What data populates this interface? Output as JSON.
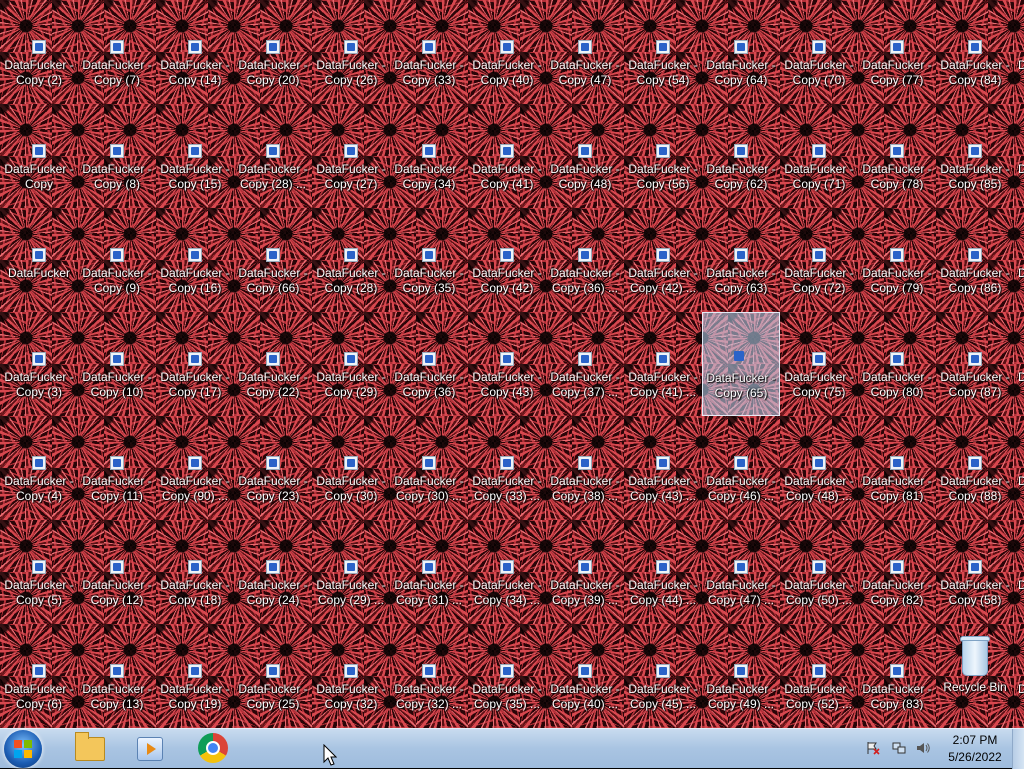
{
  "desktop": {
    "icons": [
      {
        "id": "c0-0",
        "label": "DataFucker -\nCopy (2)",
        "kind": "shortcut"
      },
      {
        "id": "c0-1",
        "label": "DataFucker -\nCopy",
        "kind": "shortcut"
      },
      {
        "id": "c0-2",
        "label": "DataFucker",
        "kind": "shortcut"
      },
      {
        "id": "c0-3",
        "label": "DataFucker -\nCopy (3)",
        "kind": "shortcut"
      },
      {
        "id": "c0-4",
        "label": "DataFucker -\nCopy (4)",
        "kind": "shortcut"
      },
      {
        "id": "c0-5",
        "label": "DataFucker -\nCopy (5)",
        "kind": "shortcut"
      },
      {
        "id": "c0-6",
        "label": "DataFucker -\nCopy (6)",
        "kind": "shortcut"
      },
      {
        "id": "c1-0",
        "label": "DataFucker -\nCopy (7)",
        "kind": "shortcut"
      },
      {
        "id": "c1-1",
        "label": "DataFucker -\nCopy (8)",
        "kind": "shortcut"
      },
      {
        "id": "c1-2",
        "label": "DataFucker -\nCopy (9)",
        "kind": "shortcut"
      },
      {
        "id": "c1-3",
        "label": "DataFucker -\nCopy (10)",
        "kind": "shortcut"
      },
      {
        "id": "c1-4",
        "label": "DataFucker -\nCopy (11)",
        "kind": "shortcut"
      },
      {
        "id": "c1-5",
        "label": "DataFucker -\nCopy (12)",
        "kind": "shortcut"
      },
      {
        "id": "c1-6",
        "label": "DataFucker -\nCopy (13)",
        "kind": "shortcut"
      },
      {
        "id": "c2-0",
        "label": "DataFucker -\nCopy (14)",
        "kind": "shortcut"
      },
      {
        "id": "c2-1",
        "label": "DataFucker -\nCopy (15)",
        "kind": "shortcut"
      },
      {
        "id": "c2-2",
        "label": "DataFucker -\nCopy (16)",
        "kind": "shortcut"
      },
      {
        "id": "c2-3",
        "label": "DataFucker -\nCopy (17)",
        "kind": "shortcut"
      },
      {
        "id": "c2-4",
        "label": "DataFucker -\nCopy (90) ...",
        "kind": "shortcut"
      },
      {
        "id": "c2-5",
        "label": "DataFucker -\nCopy (18)",
        "kind": "shortcut"
      },
      {
        "id": "c2-6",
        "label": "DataFucker -\nCopy (19)",
        "kind": "shortcut"
      },
      {
        "id": "c3-0",
        "label": "DataFucker -\nCopy (20)",
        "kind": "shortcut"
      },
      {
        "id": "c3-1",
        "label": "DataFucker -\nCopy (28) ...",
        "kind": "shortcut"
      },
      {
        "id": "c3-2",
        "label": "DataFucker -\nCopy (66)",
        "kind": "shortcut"
      },
      {
        "id": "c3-3",
        "label": "DataFucker -\nCopy (22)",
        "kind": "shortcut"
      },
      {
        "id": "c3-4",
        "label": "DataFucker -\nCopy (23)",
        "kind": "shortcut"
      },
      {
        "id": "c3-5",
        "label": "DataFucker -\nCopy (24)",
        "kind": "shortcut"
      },
      {
        "id": "c3-6",
        "label": "DataFucker -\nCopy (25)",
        "kind": "shortcut"
      },
      {
        "id": "c4-0",
        "label": "DataFucker -\nCopy (26)",
        "kind": "shortcut"
      },
      {
        "id": "c4-1",
        "label": "DataFucker -\nCopy (27)",
        "kind": "shortcut"
      },
      {
        "id": "c4-2",
        "label": "DataFucker -\nCopy (28)",
        "kind": "shortcut"
      },
      {
        "id": "c4-3",
        "label": "DataFucker -\nCopy (29)",
        "kind": "shortcut"
      },
      {
        "id": "c4-4",
        "label": "DataFucker -\nCopy (30)",
        "kind": "shortcut"
      },
      {
        "id": "c4-5",
        "label": "DataFucker -\nCopy (29) ...",
        "kind": "shortcut"
      },
      {
        "id": "c4-6",
        "label": "DataFucker -\nCopy (32)",
        "kind": "shortcut"
      },
      {
        "id": "c5-0",
        "label": "DataFucker -\nCopy (33)",
        "kind": "shortcut"
      },
      {
        "id": "c5-1",
        "label": "DataFucker -\nCopy (34)",
        "kind": "shortcut"
      },
      {
        "id": "c5-2",
        "label": "DataFucker -\nCopy (35)",
        "kind": "shortcut"
      },
      {
        "id": "c5-3",
        "label": "DataFucker -\nCopy (36)",
        "kind": "shortcut"
      },
      {
        "id": "c5-4",
        "label": "DataFucker -\nCopy (30) ...",
        "kind": "shortcut"
      },
      {
        "id": "c5-5",
        "label": "DataFucker -\nCopy (31) ...",
        "kind": "shortcut"
      },
      {
        "id": "c5-6",
        "label": "DataFucker -\nCopy (32) ...",
        "kind": "shortcut"
      },
      {
        "id": "c6-0",
        "label": "DataFucker -\nCopy (40)",
        "kind": "shortcut"
      },
      {
        "id": "c6-1",
        "label": "DataFucker -\nCopy (41)",
        "kind": "shortcut"
      },
      {
        "id": "c6-2",
        "label": "DataFucker -\nCopy (42)",
        "kind": "shortcut"
      },
      {
        "id": "c6-3",
        "label": "DataFucker -\nCopy (43)",
        "kind": "shortcut"
      },
      {
        "id": "c6-4",
        "label": "DataFucker -\nCopy (33) ...",
        "kind": "shortcut"
      },
      {
        "id": "c6-5",
        "label": "DataFucker -\nCopy (34) ...",
        "kind": "shortcut"
      },
      {
        "id": "c6-6",
        "label": "DataFucker -\nCopy (35) ...",
        "kind": "shortcut"
      },
      {
        "id": "c7-0",
        "label": "DataFucker -\nCopy (47)",
        "kind": "shortcut"
      },
      {
        "id": "c7-1",
        "label": "DataFucker -\nCopy (48)",
        "kind": "shortcut"
      },
      {
        "id": "c7-2",
        "label": "DataFucker -\nCopy (36) ...",
        "kind": "shortcut"
      },
      {
        "id": "c7-3",
        "label": "DataFucker -\nCopy (37) ...",
        "kind": "shortcut"
      },
      {
        "id": "c7-4",
        "label": "DataFucker -\nCopy (38) ...",
        "kind": "shortcut"
      },
      {
        "id": "c7-5",
        "label": "DataFucker -\nCopy (39) ...",
        "kind": "shortcut"
      },
      {
        "id": "c7-6",
        "label": "DataFucker -\nCopy (40) ...",
        "kind": "shortcut"
      },
      {
        "id": "c8-0",
        "label": "DataFucker -\nCopy (54)",
        "kind": "shortcut"
      },
      {
        "id": "c8-1",
        "label": "DataFucker -\nCopy (56)",
        "kind": "shortcut"
      },
      {
        "id": "c8-2",
        "label": "DataFucker -\nCopy (42) ...",
        "kind": "shortcut"
      },
      {
        "id": "c8-3",
        "label": "DataFucker -\nCopy (41) ...",
        "kind": "shortcut"
      },
      {
        "id": "c8-4",
        "label": "DataFucker -\nCopy (43) ...",
        "kind": "shortcut"
      },
      {
        "id": "c8-5",
        "label": "DataFucker -\nCopy (44) ...",
        "kind": "shortcut"
      },
      {
        "id": "c8-6",
        "label": "DataFucker -\nCopy (45) ...",
        "kind": "shortcut"
      },
      {
        "id": "c9-0",
        "label": "DataFucker -\nCopy (64)",
        "kind": "shortcut"
      },
      {
        "id": "c9-1",
        "label": "DataFucker -\nCopy (62)",
        "kind": "shortcut"
      },
      {
        "id": "c9-2",
        "label": "DataFucker -\nCopy (63)",
        "kind": "shortcut"
      },
      {
        "id": "c9-3",
        "label": "DataFucker -\nCopy (65)",
        "kind": "shortcut",
        "selected": true
      },
      {
        "id": "c9-4",
        "label": "DataFucker -\nCopy (46) ...",
        "kind": "shortcut"
      },
      {
        "id": "c9-5",
        "label": "DataFucker -\nCopy (47) ...",
        "kind": "shortcut"
      },
      {
        "id": "c9-6",
        "label": "DataFucker -\nCopy (49) ...",
        "kind": "shortcut"
      },
      {
        "id": "c10-0",
        "label": "DataFucker -\nCopy (70)",
        "kind": "shortcut"
      },
      {
        "id": "c10-1",
        "label": "DataFucker -\nCopy (71)",
        "kind": "shortcut"
      },
      {
        "id": "c10-2",
        "label": "DataFucker -\nCopy (72)",
        "kind": "shortcut"
      },
      {
        "id": "c10-3",
        "label": "DataFucker -\nCopy (75)",
        "kind": "shortcut"
      },
      {
        "id": "c10-4",
        "label": "DataFucker -\nCopy (48) ...",
        "kind": "shortcut"
      },
      {
        "id": "c10-5",
        "label": "DataFucker -\nCopy (50) ...",
        "kind": "shortcut"
      },
      {
        "id": "c10-6",
        "label": "DataFucker -\nCopy (52) ...",
        "kind": "shortcut"
      },
      {
        "id": "c11-0",
        "label": "DataFucker -\nCopy (77)",
        "kind": "shortcut"
      },
      {
        "id": "c11-1",
        "label": "DataFucker -\nCopy (78)",
        "kind": "shortcut"
      },
      {
        "id": "c11-2",
        "label": "DataFucker -\nCopy (79)",
        "kind": "shortcut"
      },
      {
        "id": "c11-3",
        "label": "DataFucker -\nCopy (80)",
        "kind": "shortcut"
      },
      {
        "id": "c11-4",
        "label": "DataFucker -\nCopy (81)",
        "kind": "shortcut"
      },
      {
        "id": "c11-5",
        "label": "DataFucker -\nCopy (82)",
        "kind": "shortcut"
      },
      {
        "id": "c11-6",
        "label": "DataFucker -\nCopy (83)",
        "kind": "shortcut"
      },
      {
        "id": "c12-0",
        "label": "DataFucker -\nCopy (84)",
        "kind": "shortcut"
      },
      {
        "id": "c12-1",
        "label": "DataFucker -\nCopy (85)",
        "kind": "shortcut"
      },
      {
        "id": "c12-2",
        "label": "DataFucker -\nCopy (86)",
        "kind": "shortcut"
      },
      {
        "id": "c12-3",
        "label": "DataFucker -\nCopy (87)",
        "kind": "shortcut"
      },
      {
        "id": "c12-4",
        "label": "DataFucker -\nCopy (88)",
        "kind": "shortcut"
      },
      {
        "id": "c12-5",
        "label": "DataFucker -\nCopy (58)",
        "kind": "shortcut"
      },
      {
        "id": "c12-6",
        "label": "Recycle Bin",
        "kind": "recycle-bin"
      }
    ],
    "edge_clipped_labels": [
      "D",
      "D",
      "D",
      "D",
      "D",
      "D",
      "D"
    ],
    "colors": {
      "wallpaper_red": "#d8484f",
      "wallpaper_dark": "#070000",
      "selection": "#bedcfa"
    }
  },
  "taskbar": {
    "start_button_icon": "windows-logo-icon",
    "pinned": [
      {
        "name": "windows-explorer",
        "icon": "folder-icon"
      },
      {
        "name": "windows-media-player",
        "icon": "media-player-icon"
      },
      {
        "name": "google-chrome",
        "icon": "chrome-icon"
      }
    ],
    "tray_icons": [
      "action-center-flag-icon",
      "network-icon",
      "volume-icon"
    ],
    "clock": {
      "time": "2:07 PM",
      "date": "5/26/2022"
    },
    "colors": {
      "bar_top": "#c8dbef",
      "bar_bottom": "#9fbcdd"
    }
  }
}
